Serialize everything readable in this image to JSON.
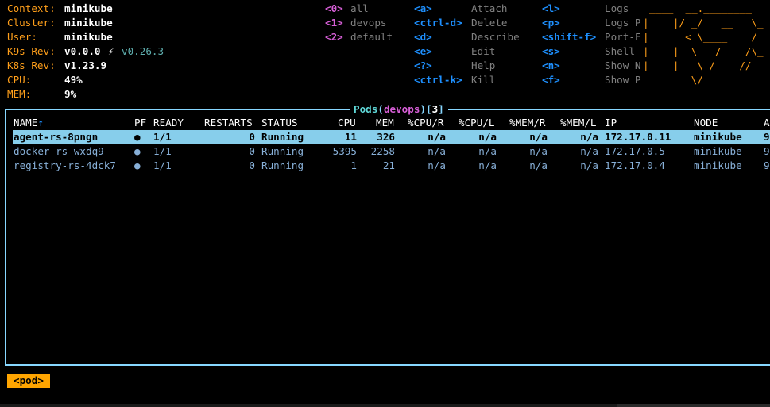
{
  "info": [
    {
      "label": "Context:",
      "value": "minikube"
    },
    {
      "label": "Cluster:",
      "value": "minikube"
    },
    {
      "label": "User:",
      "value": "minikube"
    },
    {
      "label": "K9s Rev:",
      "value": "v0.0.0",
      "extra_icon": "⚡",
      "extra": "v0.26.3"
    },
    {
      "label": "K8s Rev:",
      "value": "v1.23.9"
    },
    {
      "label": "CPU:",
      "value": "49%"
    },
    {
      "label": "MEM:",
      "value": "9%"
    }
  ],
  "namespaces": [
    {
      "key": "<0>",
      "label": "all"
    },
    {
      "key": "<1>",
      "label": "devops"
    },
    {
      "key": "<2>",
      "label": "default"
    }
  ],
  "hotkeys_col1": [
    {
      "key": "<a>",
      "label": "Attach"
    },
    {
      "key": "<ctrl-d>",
      "label": "Delete"
    },
    {
      "key": "<d>",
      "label": "Describe"
    },
    {
      "key": "<e>",
      "label": "Edit"
    },
    {
      "key": "<?>",
      "label": "Help"
    },
    {
      "key": "<ctrl-k>",
      "label": "Kill"
    }
  ],
  "hotkeys_col2": [
    {
      "key": "<l>",
      "label": "Logs"
    },
    {
      "key": "<p>",
      "label": "Logs P"
    },
    {
      "key": "<shift-f>",
      "label": "Port-F"
    },
    {
      "key": "<s>",
      "label": "Shell"
    },
    {
      "key": "<n>",
      "label": "Show N"
    },
    {
      "key": "<f>",
      "label": "Show P"
    }
  ],
  "logo_lines": [
    "____  __.________",
    "|    |/ _/   __   \\_",
    "|      < \\____    /",
    "|    |  \\   /    /\\_",
    "|____|__ \\ /____//__",
    "        \\/"
  ],
  "table": {
    "title": "Pods",
    "namespace": "devops",
    "count": "3",
    "sort_indicator": "↑",
    "headers": [
      "NAME",
      "PF",
      "READY",
      "RESTARTS",
      "STATUS",
      "CPU",
      "MEM",
      "%CPU/R",
      "%CPU/L",
      "%MEM/R",
      "%MEM/L",
      "IP",
      "NODE",
      "A"
    ],
    "rows": [
      {
        "name": "agent-rs-8pngn",
        "pf": "●",
        "ready": "1/1",
        "restarts": "0",
        "status": "Running",
        "cpu": "11",
        "mem": "326",
        "cpur": "n/a",
        "cpul": "n/a",
        "memr": "n/a",
        "meml": "n/a",
        "ip": "172.17.0.11",
        "node": "minikube",
        "age": "9"
      },
      {
        "name": "docker-rs-wxdq9",
        "pf": "●",
        "ready": "1/1",
        "restarts": "0",
        "status": "Running",
        "cpu": "5395",
        "mem": "2258",
        "cpur": "n/a",
        "cpul": "n/a",
        "memr": "n/a",
        "meml": "n/a",
        "ip": "172.17.0.5",
        "node": "minikube",
        "age": "9"
      },
      {
        "name": "registry-rs-4dck7",
        "pf": "●",
        "ready": "1/1",
        "restarts": "0",
        "status": "Running",
        "cpu": "1",
        "mem": "21",
        "cpur": "n/a",
        "cpul": "n/a",
        "memr": "n/a",
        "meml": "n/a",
        "ip": "172.17.0.4",
        "node": "minikube",
        "age": "9"
      }
    ]
  },
  "breadcrumb": "<pod>",
  "colors": {
    "accent": "#ff9f1a",
    "frame": "#87d7ff",
    "selected_row": "#87ceeb",
    "hotkey": "#1e90ff",
    "namespace_key": "#d75fd7"
  }
}
